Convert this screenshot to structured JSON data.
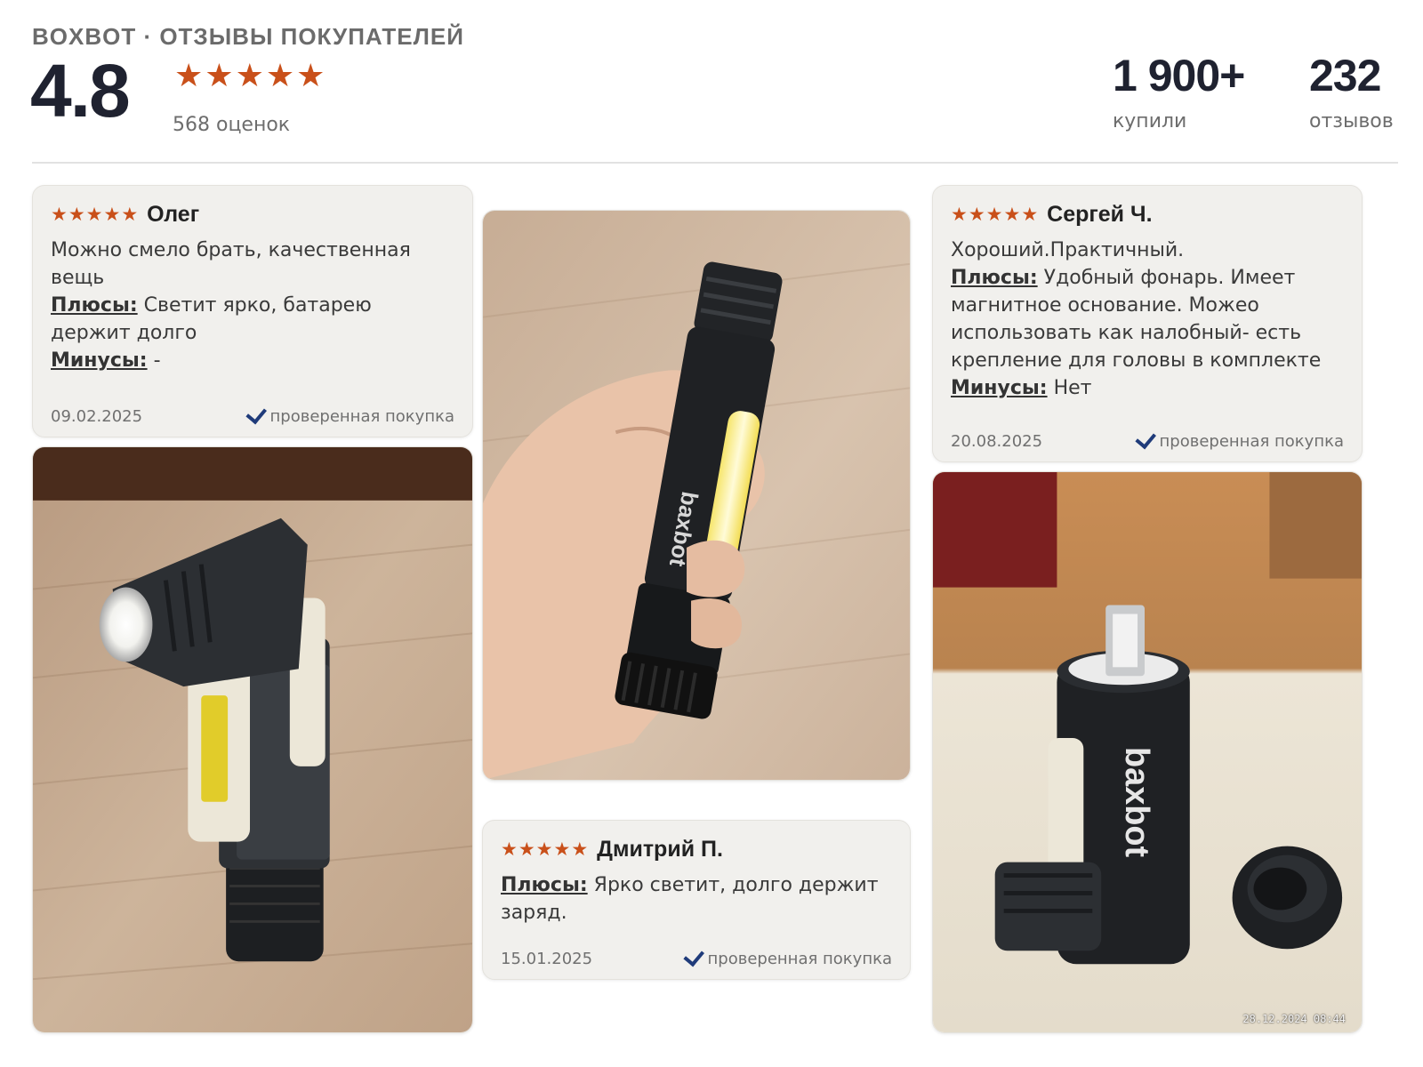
{
  "header": {
    "brand": "BOXBOT · ОТЗЫВЫ ПОКУПАТЕЛЕЙ",
    "rating": "4.8",
    "rating_count": "568 оценок",
    "stats": [
      {
        "value": "1 900+",
        "label": "купили"
      },
      {
        "value": "232",
        "label": "отзывов"
      }
    ]
  },
  "reviews": [
    {
      "name": "Олег",
      "stars": 5,
      "text": "Можно смело брать, качественная вещь",
      "pros_label": "Плюсы:",
      "pros": "Светит ярко, батарею держит долго",
      "cons_label": "Минусы:",
      "cons": "-",
      "date": "09.02.2025",
      "verified": "проверенная покупка"
    },
    {
      "name": "Дмитрий П.",
      "stars": 5,
      "pros_label": "Плюсы:",
      "pros": "Ярко светит, долго держит заряд.",
      "date": "15.01.2025",
      "verified": "проверенная покупка"
    },
    {
      "name": "Сергей Ч.",
      "stars": 5,
      "text": "Хороший.Практичный.",
      "pros_label": "Плюсы:",
      "pros": "Удобный фонарь. Имеет магнитное основание. Можео использовать как налобный- есть крепление для головы в комплекте",
      "cons_label": "Минусы:",
      "cons": "Нет",
      "date": "20.08.2025",
      "verified": "проверенная покупка"
    }
  ],
  "photos": {
    "brand_on_device": "baxbot",
    "timestamp": "28.12.2024 08:44"
  },
  "colors": {
    "star": "#c9501a",
    "card_bg": "#f1f0ed",
    "check": "#1f3b7a",
    "heading": "#1f2230"
  }
}
